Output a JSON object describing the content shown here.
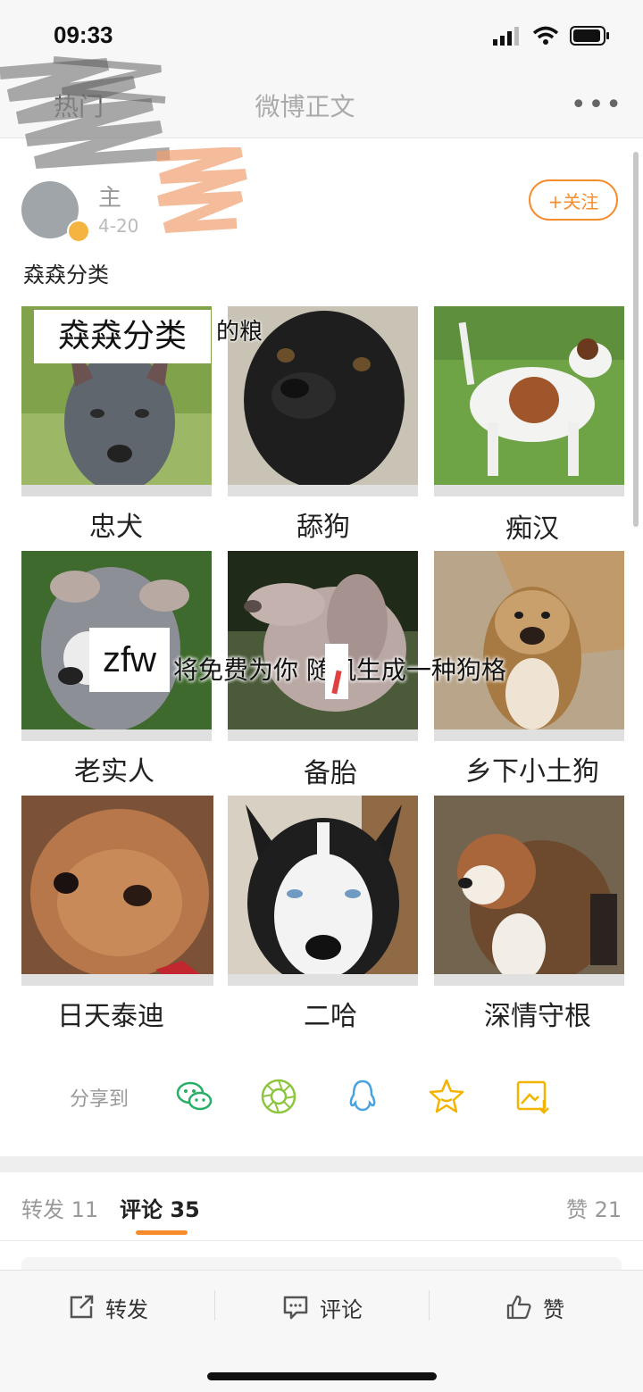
{
  "status_bar": {
    "time": "09:33"
  },
  "nav": {
    "title": "微博正文",
    "back_label": "热门",
    "more": "•••"
  },
  "post": {
    "author": "主",
    "time": "4-20",
    "follow_label": "+关注",
    "text": "猋猋分类",
    "image": {
      "overlay_title": "猋猋分类",
      "overlay_partial": "的粮",
      "overlay_zfw": "zfw",
      "overlay_line": "将免费为你  随机生成一种狗格",
      "captions": [
        "忠犬",
        "舔狗",
        "痴汉",
        "老实人",
        "备胎",
        "乡下小土狗",
        "日天泰迪",
        "二哈",
        "深情守根"
      ]
    }
  },
  "share": {
    "label": "分享到",
    "icons": [
      "wechat-icon",
      "moments-icon",
      "qq-icon",
      "favorite-icon",
      "save-image-icon"
    ]
  },
  "tabs": {
    "repost": "转发 11",
    "comment_name": "评论",
    "comment_count": "35",
    "like": "赞 21"
  },
  "toolbar": {
    "repost": "转发",
    "comment": "评论",
    "like": "赞"
  },
  "colors": {
    "accent": "#f78c2c",
    "wechat": "#2aae67",
    "moments": "#8cc63f",
    "qq": "#4aa3df",
    "favorite": "#f2b400"
  }
}
